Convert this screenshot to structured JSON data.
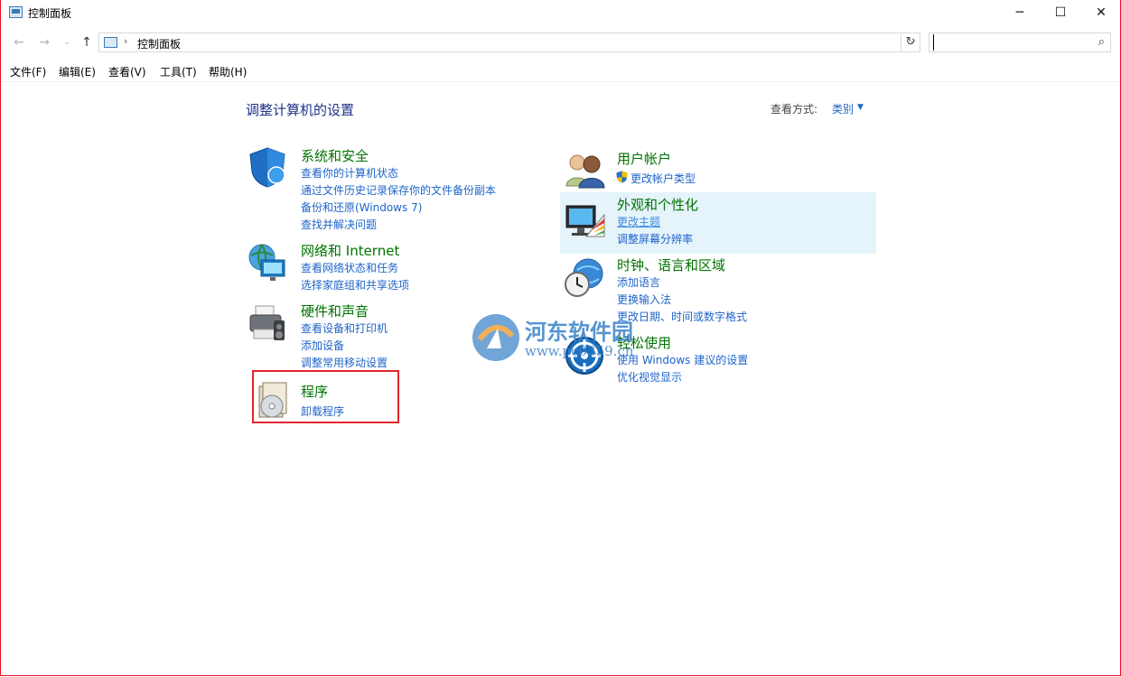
{
  "window": {
    "title": "控制面板",
    "controls": {
      "minimize": "─",
      "maximize": "☐",
      "close": "✕"
    }
  },
  "address": {
    "crumb": "控制面板",
    "search_placeholder": ""
  },
  "menu": [
    "文件(F)",
    "编辑(E)",
    "查看(V)",
    "工具(T)",
    "帮助(H)"
  ],
  "main": {
    "heading": "调整计算机的设置",
    "view_by_label": "查看方式:",
    "view_by_value": "类别"
  },
  "categories": [
    {
      "title": "系统和安全",
      "icon": "shield-icon",
      "links": [
        "查看你的计算机状态",
        "通过文件历史记录保存你的文件备份副本",
        "备份和还原(Windows 7)",
        "查找并解决问题"
      ]
    },
    {
      "title": "网络和 Internet",
      "icon": "network-globe-icon",
      "links": [
        "查看网络状态和任务",
        "选择家庭组和共享选项"
      ]
    },
    {
      "title": "硬件和声音",
      "icon": "printer-icon",
      "links": [
        "查看设备和打印机",
        "添加设备",
        "调整常用移动设置"
      ]
    },
    {
      "title": "程序",
      "icon": "programs-disc-icon",
      "links": [
        "卸载程序"
      ]
    },
    {
      "title": "用户帐户",
      "icon": "users-icon",
      "links": [
        "更改帐户类型"
      ]
    },
    {
      "title": "外观和个性化",
      "icon": "monitor-palette-icon",
      "links": [
        "更改主题",
        "调整屏幕分辨率"
      ]
    },
    {
      "title": "时钟、语言和区域",
      "icon": "clock-globe-icon",
      "links": [
        "添加语言",
        "更换输入法",
        "更改日期、时间或数字格式"
      ]
    },
    {
      "title": "轻松使用",
      "icon": "ease-of-access-icon",
      "links": [
        "使用 Windows 建议的设置",
        "优化视觉显示"
      ]
    }
  ],
  "watermark": {
    "text": "河东软件园",
    "url": "www.pc0359.cn"
  },
  "colors": {
    "category_title": "#007300",
    "link": "#1e64c8",
    "heading": "#1e3287",
    "highlight": "#e5f3fb",
    "callout_border": "#e0262e"
  }
}
